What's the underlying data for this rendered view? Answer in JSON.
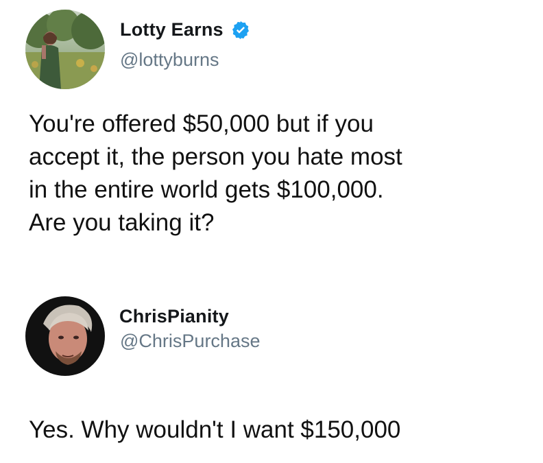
{
  "tweets": [
    {
      "display_name": "Lotty Earns",
      "handle": "@lottyburns",
      "verified": true,
      "text": "You're offered $50,000 but if you\naccept it, the person you hate most\nin the entire world gets $100,000.\nAre you taking it?"
    },
    {
      "display_name": "ChrisPianity",
      "handle": "@ChrisPurchase",
      "verified": false,
      "text": "Yes. Why wouldn't I want $150,000"
    }
  ],
  "colors": {
    "verified_badge": "#1da1f2",
    "handle": "#657786",
    "name": "#14171a",
    "text": "#111111",
    "background": "#ffffff"
  },
  "icons": {
    "verified": "verified-badge-icon"
  }
}
